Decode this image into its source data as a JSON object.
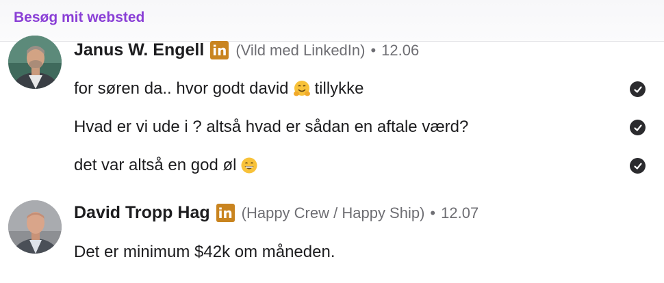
{
  "header": {
    "visit_link": "Besøg mit websted"
  },
  "messages": [
    {
      "sender": "Janus W. Engell",
      "linkedin_badge": "in",
      "affiliation": "(Vild med LinkedIn)",
      "separator": "•",
      "time": "12.06",
      "lines": [
        {
          "text_before": "for søren da.. hvor godt david",
          "emoji": "hugging-face",
          "text_after": "tillykke",
          "read": true
        },
        {
          "text_before": "Hvad er vi ude i ? altså hvad er sådan en aftale værd?",
          "emoji": "",
          "text_after": "",
          "read": true
        },
        {
          "text_before": "det var altså en god øl",
          "emoji": "grinning-face",
          "text_after": "",
          "read": true
        }
      ]
    },
    {
      "sender": "David Tropp Hag",
      "linkedin_badge": "in",
      "affiliation": "(Happy Crew / Happy Ship)",
      "separator": "•",
      "time": "12.07",
      "lines": [
        {
          "text_before": "Det er minimum $42k om måneden.",
          "emoji": "",
          "text_after": "",
          "read": false
        }
      ]
    }
  ],
  "colors": {
    "link": "#8a3fd6",
    "linkedin_badge": "#c9841f",
    "meta_text": "#6e6e73",
    "check_icon": "#2b2b2e"
  }
}
